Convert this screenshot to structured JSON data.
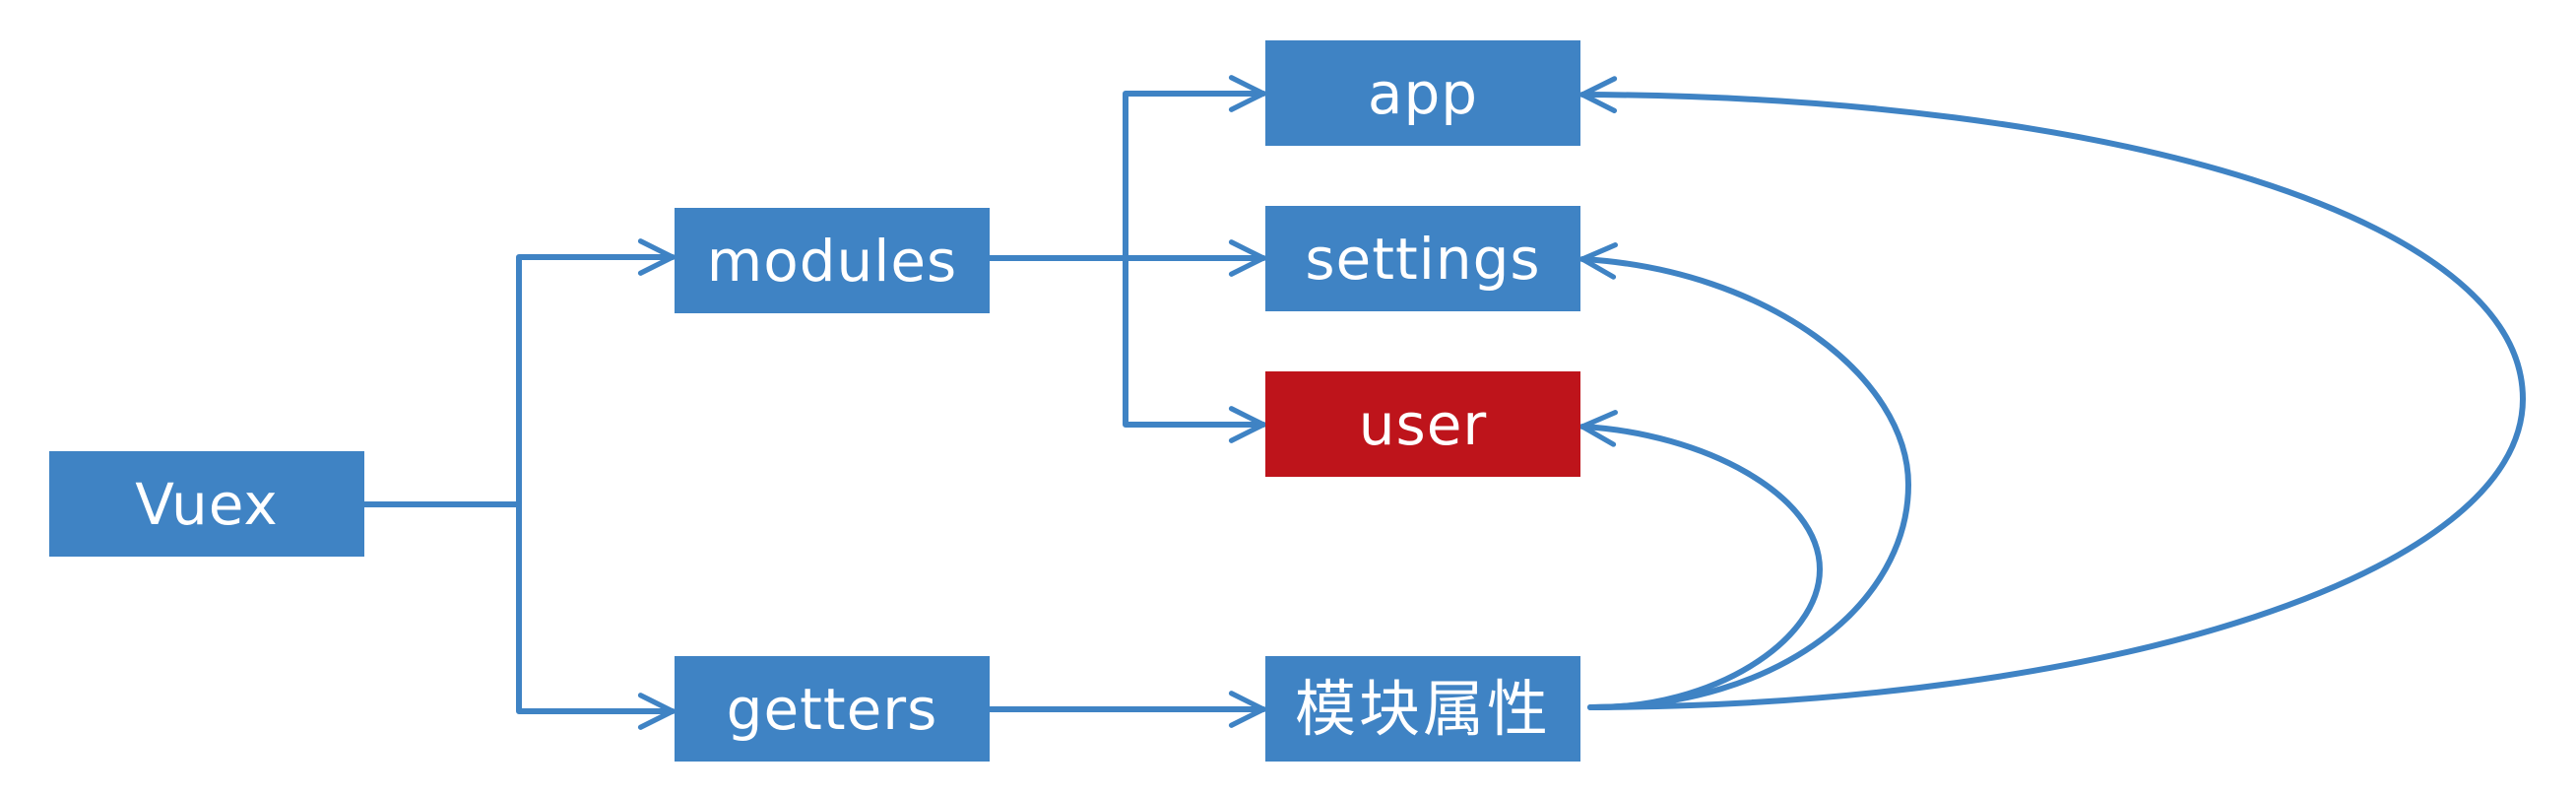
{
  "colors": {
    "node_fill": "#3f83c4",
    "highlight_fill": "#be141b",
    "edge_stroke": "#3f83c4",
    "background": "#ffffff"
  },
  "nodes": {
    "vuex": {
      "label": "Vuex"
    },
    "modules": {
      "label": "modules"
    },
    "getters": {
      "label": "getters"
    },
    "app": {
      "label": "app"
    },
    "settings": {
      "label": "settings"
    },
    "user": {
      "label": "user"
    },
    "props": {
      "label": "模块属性"
    }
  },
  "edges": [
    {
      "from": "vuex",
      "to": "modules"
    },
    {
      "from": "vuex",
      "to": "getters"
    },
    {
      "from": "modules",
      "to": "app"
    },
    {
      "from": "modules",
      "to": "settings"
    },
    {
      "from": "modules",
      "to": "user"
    },
    {
      "from": "getters",
      "to": "props"
    },
    {
      "from": "props",
      "to": "app"
    },
    {
      "from": "props",
      "to": "settings"
    },
    {
      "from": "props",
      "to": "user"
    }
  ],
  "highlighted_node": "user"
}
